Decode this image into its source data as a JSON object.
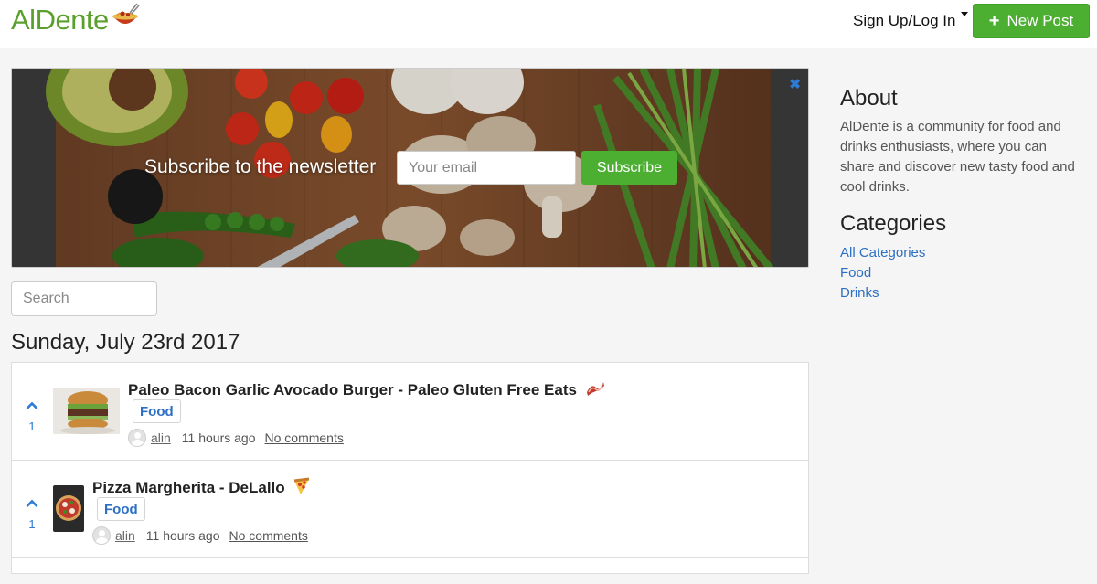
{
  "header": {
    "logo_text": "AlDente",
    "signup_label": "Sign Up/Log In",
    "new_post_label": "New Post",
    "brand_color": "#5aa02c"
  },
  "banner": {
    "title": "Subscribe to the newsletter",
    "email_placeholder": "Your email",
    "subscribe_label": "Subscribe",
    "close_icon": "close-icon"
  },
  "search": {
    "placeholder": "Search"
  },
  "feed": {
    "date_heading": "Sunday, July 23rd 2017",
    "posts": [
      {
        "votes": "1",
        "title": "Paleo Bacon Garlic Avocado Burger - Paleo Gluten Free Eats",
        "emoji": "bacon-icon",
        "category": "Food",
        "author": "alin",
        "time": "11 hours ago",
        "comments": "No comments"
      },
      {
        "votes": "1",
        "title": "Pizza Margherita - DeLallo",
        "emoji": "pizza-icon",
        "category": "Food",
        "author": "alin",
        "time": "11 hours ago",
        "comments": "No comments"
      }
    ]
  },
  "sidebar": {
    "about_title": "About",
    "about_text": "AlDente is a community for food and drinks enthusiasts, where you can share and discover new tasty food and cool drinks.",
    "categories_title": "Categories",
    "categories": [
      "All Categories",
      "Food",
      "Drinks"
    ]
  }
}
